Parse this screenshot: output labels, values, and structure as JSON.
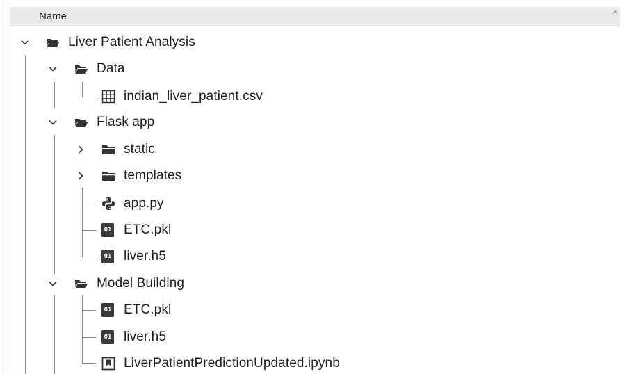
{
  "header": {
    "column_label": "Name"
  },
  "tree": {
    "root": {
      "label": "Liver Patient Analysis",
      "expanded": true,
      "icon": "folder-open-icon"
    },
    "data_folder": {
      "label": "Data",
      "expanded": true,
      "icon": "folder-open-icon",
      "files": [
        {
          "label": "indian_liver_patient.csv",
          "icon": "table-icon"
        }
      ]
    },
    "flask_folder": {
      "label": "Flask app",
      "expanded": true,
      "icon": "folder-open-icon",
      "subfolders": [
        {
          "label": "static",
          "expanded": false,
          "icon": "folder-icon"
        },
        {
          "label": "templates",
          "expanded": false,
          "icon": "folder-icon"
        }
      ],
      "files": [
        {
          "label": "app.py",
          "icon": "python-icon"
        },
        {
          "label": "ETC.pkl",
          "icon": "binary-file-icon"
        },
        {
          "label": "liver.h5",
          "icon": "binary-file-icon"
        }
      ]
    },
    "model_folder": {
      "label": "Model Building",
      "expanded": true,
      "icon": "folder-open-icon",
      "files": [
        {
          "label": "ETC.pkl",
          "icon": "binary-file-icon"
        },
        {
          "label": "liver.h5",
          "icon": "binary-file-icon"
        },
        {
          "label": "LiverPatientPredictionUpdated.ipynb",
          "icon": "notebook-icon"
        }
      ]
    }
  },
  "icons": {
    "binary_glyph": "01"
  },
  "colors": {
    "header_bg": "#e9e9e9",
    "icon_dark": "#3a3a3a",
    "guide_line": "#8a8a8a",
    "text": "#1f1f1f"
  }
}
